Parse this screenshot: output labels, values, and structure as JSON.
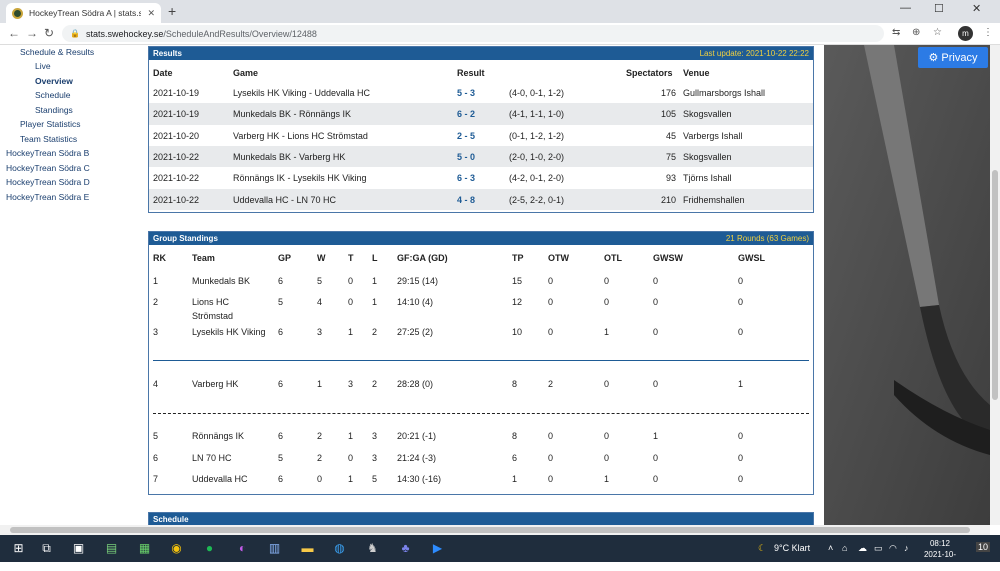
{
  "browser": {
    "tab_title": "HockeyTrean Södra A | stats.swe",
    "tab_close": "✕",
    "new_tab": "+",
    "url_host": "stats.swehockey.se",
    "url_path": "/ScheduleAndResults/Overview/12488",
    "profile_initial": "m",
    "win_min": "—",
    "win_max": "☐",
    "win_close": "✕"
  },
  "sidebar": {
    "items": [
      {
        "label": "Schedule & Results"
      },
      {
        "label": "Live"
      },
      {
        "label": "Overview"
      },
      {
        "label": "Schedule"
      },
      {
        "label": "Standings"
      },
      {
        "label": "Player Statistics"
      },
      {
        "label": "Team Statistics"
      },
      {
        "label": "HockeyTrean Södra B"
      },
      {
        "label": "HockeyTrean Södra C"
      },
      {
        "label": "HockeyTrean Södra D"
      },
      {
        "label": "HockeyTrean Södra E"
      }
    ]
  },
  "results": {
    "title": "Results",
    "last_update": "Last update: 2021-10-22 22:22",
    "headers": {
      "date": "Date",
      "game": "Game",
      "result": "Result",
      "spectators": "Spectators",
      "venue": "Venue"
    },
    "rows": [
      {
        "date": "2021-10-19",
        "game": "Lysekils HK Viking  -  Uddevalla HC",
        "result": "5 - 3",
        "periods": "(4-0, 0-1, 1-2)",
        "spectators": "176",
        "venue": "Gullmarsborgs Ishall"
      },
      {
        "date": "2021-10-19",
        "game": "Munkedals BK  -  Rönnängs IK",
        "result": "6 - 2",
        "periods": "(4-1, 1-1, 1-0)",
        "spectators": "105",
        "venue": "Skogsvallen"
      },
      {
        "date": "2021-10-20",
        "game": "Varberg HK  -  Lions HC Strömstad",
        "result": "2 - 5",
        "periods": "(0-1, 1-2, 1-2)",
        "spectators": "45",
        "venue": "Varbergs Ishall"
      },
      {
        "date": "2021-10-22",
        "game": "Munkedals BK  -  Varberg HK",
        "result": "5 - 0",
        "periods": "(2-0, 1-0, 2-0)",
        "spectators": "75",
        "venue": "Skogsvallen"
      },
      {
        "date": "2021-10-22",
        "game": "Rönnängs IK  -  Lysekils HK Viking",
        "result": "6 - 3",
        "periods": "(4-2, 0-1, 2-0)",
        "spectators": "93",
        "venue": "Tjörns Ishall"
      },
      {
        "date": "2021-10-22",
        "game": "Uddevalla HC  -  LN 70 HC",
        "result": "4 - 8",
        "periods": "(2-5, 2-2, 0-1)",
        "spectators": "210",
        "venue": "Fridhemshallen"
      }
    ]
  },
  "standings": {
    "title": "Group Standings",
    "rounds": "21 Rounds (63 Games)",
    "headers": {
      "rk": "RK",
      "team": "Team",
      "gp": "GP",
      "w": "W",
      "t": "T",
      "l": "L",
      "gfga": "GF:GA (GD)",
      "tp": "TP",
      "otw": "OTW",
      "otl": "OTL",
      "gwsw": "GWSW",
      "gwsl": "GWSL"
    },
    "rows": [
      {
        "rk": "1",
        "team": "Munkedals BK",
        "team2": "",
        "gp": "6",
        "w": "5",
        "t": "0",
        "l": "1",
        "gfga": "29:15 (14)",
        "tp": "15",
        "otw": "0",
        "otl": "0",
        "gwsw": "0",
        "gwsl": "0"
      },
      {
        "rk": "2",
        "team": "Lions HC",
        "team2": "Strömstad",
        "gp": "5",
        "w": "4",
        "t": "0",
        "l": "1",
        "gfga": "14:10 (4)",
        "tp": "12",
        "otw": "0",
        "otl": "0",
        "gwsw": "0",
        "gwsl": "0"
      },
      {
        "rk": "3",
        "team": "Lysekils HK Viking",
        "team2": "",
        "gp": "6",
        "w": "3",
        "t": "1",
        "l": "2",
        "gfga": "27:25 (2)",
        "tp": "10",
        "otw": "0",
        "otl": "1",
        "gwsw": "0",
        "gwsl": "0"
      },
      {
        "rk": "4",
        "team": "Varberg HK",
        "team2": "",
        "gp": "6",
        "w": "1",
        "t": "3",
        "l": "2",
        "gfga": "28:28 (0)",
        "tp": "8",
        "otw": "2",
        "otl": "0",
        "gwsw": "0",
        "gwsl": "1"
      },
      {
        "rk": "5",
        "team": "Rönnängs IK",
        "team2": "",
        "gp": "6",
        "w": "2",
        "t": "1",
        "l": "3",
        "gfga": "20:21 (-1)",
        "tp": "8",
        "otw": "0",
        "otl": "0",
        "gwsw": "1",
        "gwsl": "0"
      },
      {
        "rk": "6",
        "team": "LN 70 HC",
        "team2": "",
        "gp": "5",
        "w": "2",
        "t": "0",
        "l": "3",
        "gfga": "21:24 (-3)",
        "tp": "6",
        "otw": "0",
        "otl": "0",
        "gwsw": "0",
        "gwsl": "0"
      },
      {
        "rk": "7",
        "team": "Uddevalla HC",
        "team2": "",
        "gp": "6",
        "w": "0",
        "t": "1",
        "l": "5",
        "gfga": "14:30 (-16)",
        "tp": "1",
        "otw": "0",
        "otl": "1",
        "gwsw": "0",
        "gwsl": "0"
      }
    ]
  },
  "schedule": {
    "title": "Schedule"
  },
  "privacy": {
    "label": "Privacy"
  },
  "taskbar": {
    "weather": "9°C  Klart",
    "time": "08:12",
    "date": "2021-10-23",
    "notifications": "10"
  }
}
